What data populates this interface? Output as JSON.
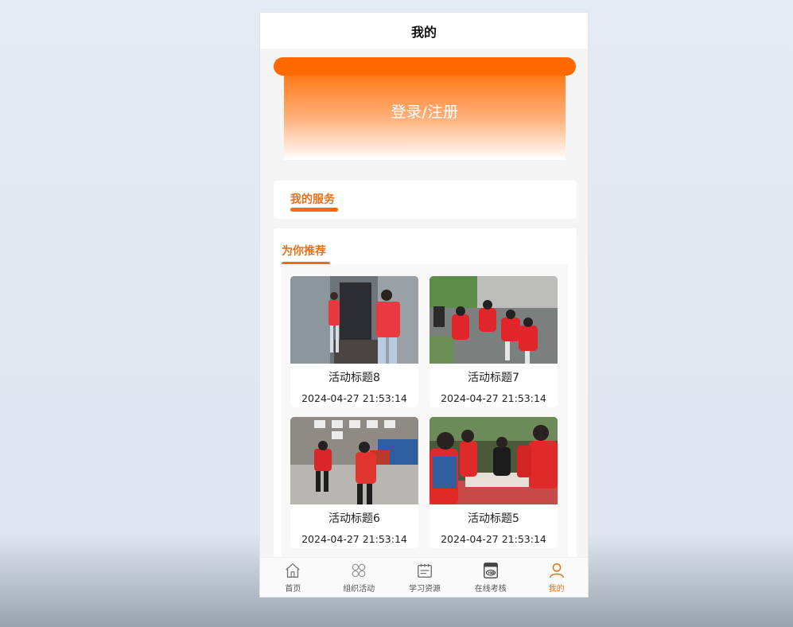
{
  "header": {
    "title": "我的"
  },
  "banner": {
    "login_label": "登录/注册"
  },
  "services": {
    "title": "我的服务"
  },
  "recommend": {
    "title": "为你推荐",
    "items": [
      {
        "title": "活动标题8",
        "time": "2024-04-27 21:53:14"
      },
      {
        "title": "活动标题7",
        "time": "2024-04-27 21:53:14"
      },
      {
        "title": "活动标题6",
        "time": "2024-04-27 21:53:14"
      },
      {
        "title": "活动标题5",
        "time": "2024-04-27 21:53:14"
      }
    ]
  },
  "tabbar": {
    "items": [
      {
        "label": "首页",
        "icon": "home-icon"
      },
      {
        "label": "组织活动",
        "icon": "grid-flower-icon"
      },
      {
        "label": "学习资源",
        "icon": "calendar-book-icon"
      },
      {
        "label": "在线考核",
        "icon": "exam-score-icon"
      },
      {
        "label": "我的",
        "icon": "user-icon"
      }
    ],
    "active_index": 4
  },
  "colors": {
    "accent": "#ff6a00",
    "accent_text": "#e8701a"
  }
}
